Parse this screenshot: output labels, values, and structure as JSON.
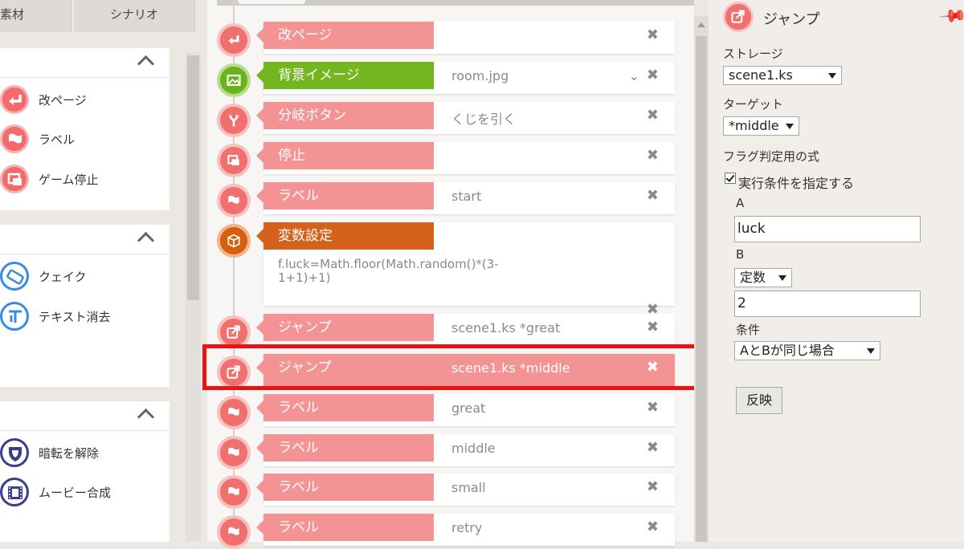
{
  "tabs": [
    "素材",
    "シナリオ"
  ],
  "palette": {
    "group1": [
      "改ページ",
      "ラベル",
      "ゲーム停止"
    ],
    "group2": [
      "クェイク",
      "テキスト消去"
    ],
    "group3": [
      "暗転を解除",
      "ムービー合成"
    ]
  },
  "timeline": {
    "rows": [
      {
        "tag": "改ページ",
        "value": ""
      },
      {
        "tag": "背景イメージ",
        "value": "room.jpg"
      },
      {
        "tag": "分岐ボタン",
        "value": "くじを引く"
      },
      {
        "tag": "停止",
        "value": ""
      },
      {
        "tag": "ラベル",
        "value": "start"
      },
      {
        "tag": "変数設定",
        "value": "f.luck=Math.floor(Math.random()*(3-1+1)+1)"
      },
      {
        "tag": "ジャンプ",
        "value": "scene1.ks *great"
      },
      {
        "tag": "ジャンプ",
        "value": "scene1.ks *middle"
      },
      {
        "tag": "ラベル",
        "value": "great"
      },
      {
        "tag": "ラベル",
        "value": "middle"
      },
      {
        "tag": "ラベル",
        "value": "small"
      },
      {
        "tag": "ラベル",
        "value": "retry"
      }
    ],
    "delete_glyph": "✖",
    "dropdown_glyph": "⌄"
  },
  "props": {
    "title": "ジャンプ",
    "storage_label": "ストレージ",
    "storage_value": "scene1.ks",
    "target_label": "ターゲット",
    "target_value": "*middle",
    "flag_label": "フラグ判定用の式",
    "condition_check_label": "実行条件を指定する",
    "a_label": "A",
    "a_value": "luck",
    "b_label": "B",
    "b_type": "定数",
    "b_value": "2",
    "cond_label": "条件",
    "cond_value": "AとBが同じ場合",
    "apply_label": "反映"
  },
  "colors": {
    "pink": "#f39393",
    "green": "#74b61f",
    "orange": "#d4621a",
    "highlight": "#ee1111"
  }
}
